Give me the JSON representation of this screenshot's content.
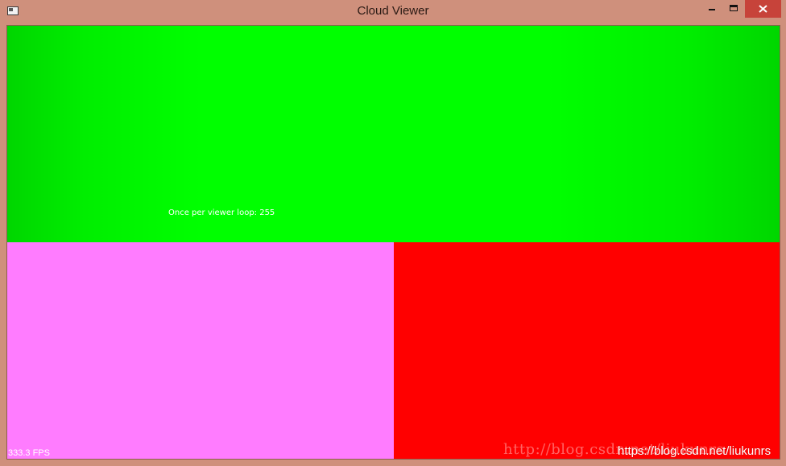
{
  "window": {
    "title": "Cloud Viewer",
    "controls": {
      "minimize": "minimize-icon",
      "maximize": "maximize-icon",
      "close": "close-icon"
    },
    "frame_color": "#cf907c",
    "close_color": "#c7433a"
  },
  "viewports": {
    "top": {
      "background": "#00ff00",
      "overlay_text": "Once per viewer loop: 255"
    },
    "bottom_left": {
      "background": "#ff7cff",
      "fps_text": "333.3 FPS"
    },
    "bottom_right": {
      "background": "#ff0000"
    }
  },
  "watermarks": {
    "faint": "http://blog.csdn.net/liukunrs",
    "overlay": "https://blog.csdn.net/liukunrs"
  }
}
